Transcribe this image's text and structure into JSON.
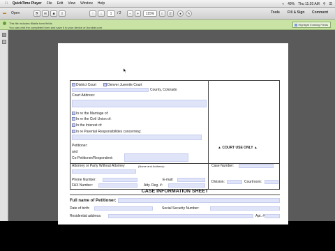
{
  "menubar": {
    "app_name": "QuickTime Player",
    "items": [
      "File",
      "Edit",
      "View",
      "Window",
      "Help"
    ],
    "battery": "49%",
    "clock": "Thu 11:20 AM"
  },
  "toolbar": {
    "open_label": "Open",
    "page_number": "1",
    "page_total": "/ 2",
    "zoom": "115%",
    "tools_label": "Tools",
    "fill_sign_label": "Fill & Sign",
    "comment_label": "Comment"
  },
  "notification": {
    "line1": "This file includes fillable form fields.",
    "line2": "You can print the completed form and save it to your device or Acrobat.com.",
    "highlight_label": "Highlight Existing Fields"
  },
  "form": {
    "district_court": "District Court",
    "denver_juvenile": "Denver Juvenile Court",
    "county": "County, Colorado",
    "court_address": "Court Address:",
    "marriage": "In re the Marriage of:",
    "civil_union": "In re the Civil Union of:",
    "interest": "In the Interest of:",
    "parental": "In re Parental Responsibilities concerning:",
    "petitioner": "Petitioner:",
    "and": "and",
    "co_petitioner": "Co-Petitioner/Respondent:",
    "court_use_only": "COURT USE ONLY",
    "attorney": "Attorney or Party Without Attorney",
    "name_address": "(Name and Address):",
    "case_number": "Case Number:",
    "phone": "Phone Number:",
    "email": "E-mail:",
    "fax": "FAX Number:",
    "atty_reg": "Atty. Reg. #:",
    "division": "Division:",
    "courtroom": "Courtroom:",
    "sheet_title": "CASE INFORMATION SHEET",
    "full_name": "Full name of Petitioner:",
    "dob": "Date of birth:",
    "ssn": "Social Security Number:",
    "residential": "Residential address:",
    "apt": "Apt. #"
  }
}
